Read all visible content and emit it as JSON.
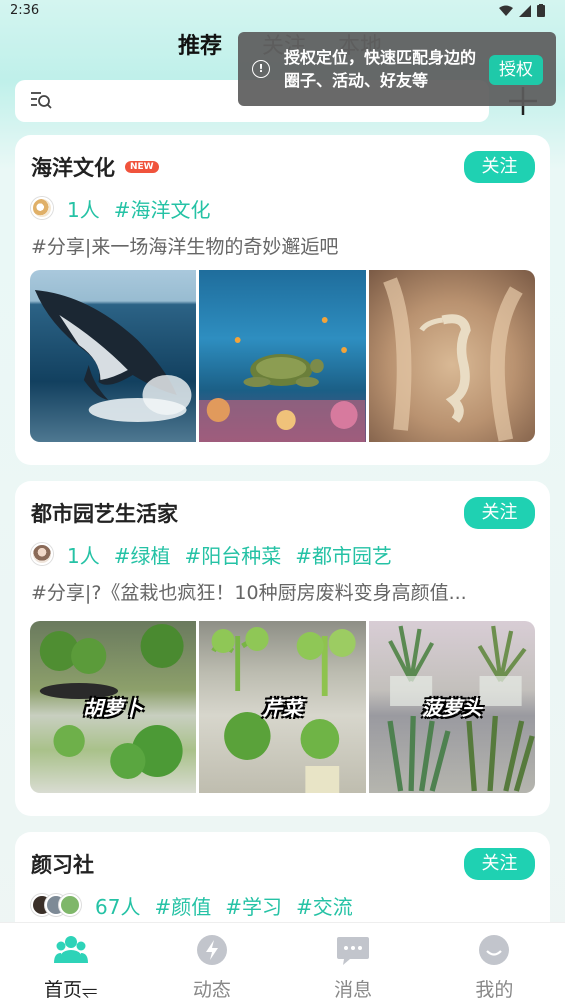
{
  "status_bar": {
    "time": "2:36"
  },
  "top_tabs": [
    {
      "label": "推荐",
      "active": true
    },
    {
      "label": "关注",
      "active": false
    },
    {
      "label": "本地",
      "active": false
    }
  ],
  "toast": {
    "message": "授权定位，快速匹配身边的圈子、活动、好友等",
    "button_label": "授权"
  },
  "cards": [
    {
      "title": "海洋文化",
      "badge": "NEW",
      "follow_label": "关注",
      "members": "1人",
      "tags": [
        "#海洋文化"
      ],
      "description": "#分享|来一场海洋生物的奇妙邂逅吧"
    },
    {
      "title": "都市园艺生活家",
      "follow_label": "关注",
      "members": "1人",
      "tags": [
        "#绿植",
        "#阳台种菜",
        "#都市园艺"
      ],
      "description": "#分享|?《盆栽也疯狂！10种厨房废料变身高颜值...",
      "image_labels": [
        "胡萝卜",
        "芹菜",
        "菠萝头"
      ]
    },
    {
      "title": "颜习社",
      "follow_label": "关注",
      "members": "67人",
      "tags": [
        "#颜值",
        "#学习",
        "#交流"
      ]
    }
  ],
  "bottom_nav": [
    {
      "label": "首页⥫",
      "icon": "community-icon",
      "active": true
    },
    {
      "label": "动态",
      "icon": "lightning-icon",
      "active": false
    },
    {
      "label": "消息",
      "icon": "chat-bubble-icon",
      "active": false
    },
    {
      "label": "我的",
      "icon": "smiley-face-icon",
      "active": false
    }
  ],
  "colors": {
    "accent": "#1fd1b2",
    "accent_text": "#25c2a5",
    "badge": "#f0533c"
  }
}
